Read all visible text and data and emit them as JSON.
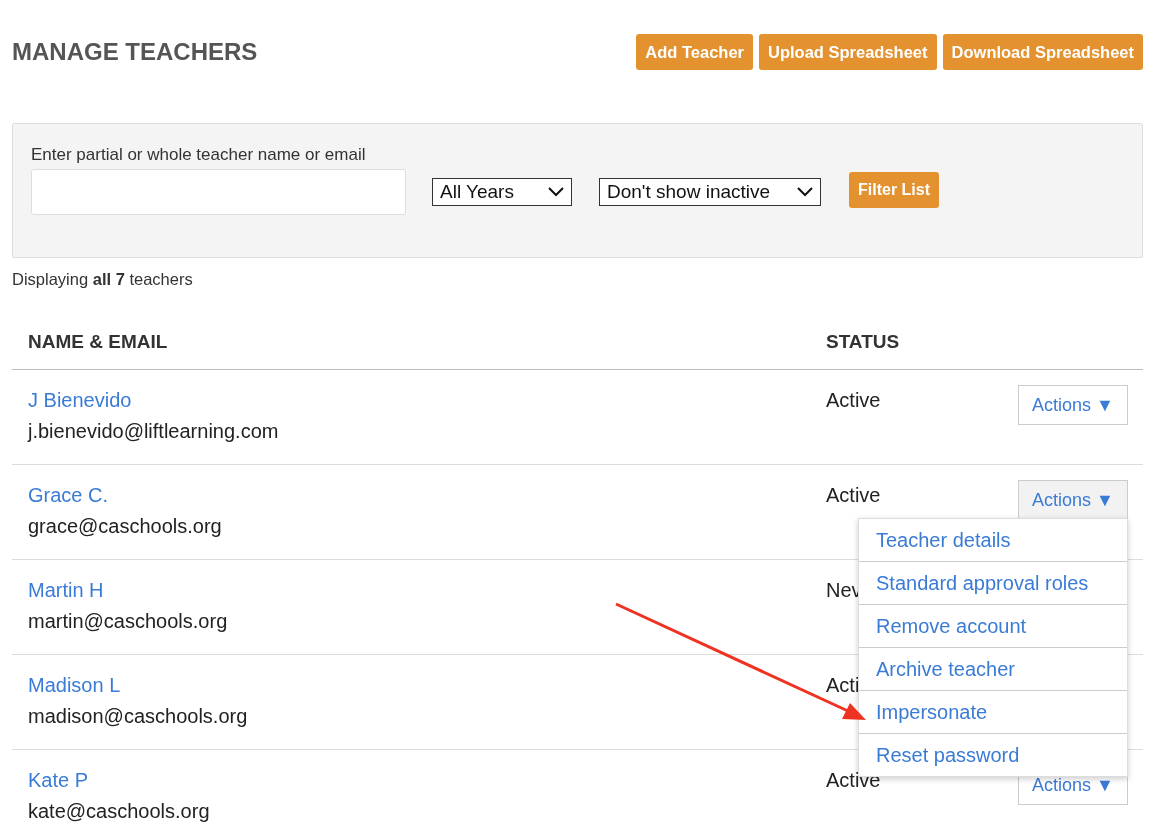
{
  "title": "MANAGE TEACHERS",
  "buttons": [
    "Add Teacher",
    "Upload Spreadsheet",
    "Download Spreadsheet"
  ],
  "filter": {
    "label": "Enter partial or whole teacher name or email",
    "years_select": "All Years",
    "inactive_select": "Don't show inactive",
    "button": "Filter List"
  },
  "summary": "Displaying **all 7** teachers",
  "table": {
    "columns": [
      "NAME & EMAIL",
      "STATUS"
    ],
    "rows": [
      {
        "name": "J Bienevido",
        "email": "j.bienevido@liftlearning.com",
        "status": "Active",
        "actions": "Actions ▼",
        "expanded": false
      },
      {
        "name": "Grace C.",
        "email": "grace@caschools.org",
        "status": "Active",
        "actions": "Actions ▼",
        "expanded": true,
        "menu": [
          "Teacher details",
          "Standard approval roles",
          "Remove account",
          "Archive teacher",
          "Impersonate",
          "Reset password"
        ]
      },
      {
        "name": "Martin H",
        "email": "martin@caschools.org",
        "status": "Nev"
      },
      {
        "name": "Madison L",
        "email": "madison@caschools.org",
        "status": "Acti"
      },
      {
        "name": "Kate P",
        "email": "kate@caschools.org",
        "status": "Active",
        "actions": "Actions ▼",
        "expanded": false
      }
    ]
  },
  "annotations": [
    {
      "kind": "arrow"
    }
  ]
}
